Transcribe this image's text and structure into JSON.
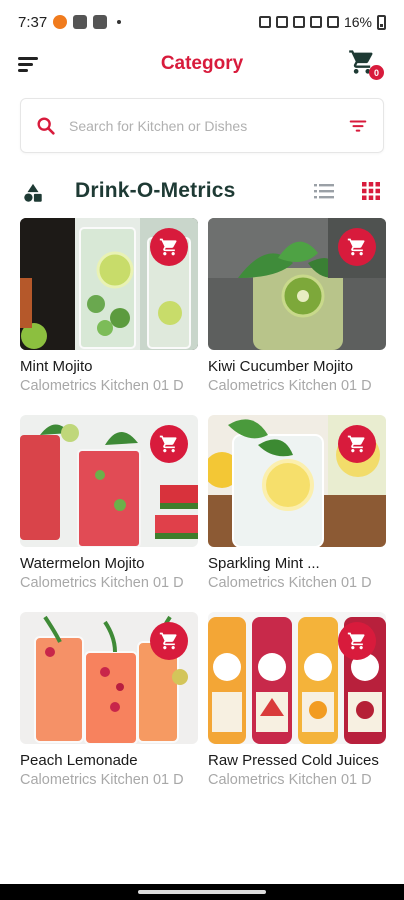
{
  "status_bar": {
    "time": "7:37",
    "battery": "16%"
  },
  "header": {
    "title": "Category",
    "cart_count": "0"
  },
  "search": {
    "placeholder": "Search for Kitchen or Dishes"
  },
  "section": {
    "title": "Drink-O-Metrics"
  },
  "colors": {
    "accent": "#d81b3c",
    "section_title": "#1e3a34",
    "subtext": "#a8a8a8"
  },
  "products": [
    {
      "name": "Mint Mojito",
      "kitchen": "Calometrics Kitchen 01 D",
      "image": "mint-mojito-photo"
    },
    {
      "name": "Kiwi Cucumber Mojito",
      "kitchen": "Calometrics Kitchen 01 D",
      "image": "kiwi-mojito-photo"
    },
    {
      "name": "Watermelon Mojito",
      "kitchen": "Calometrics Kitchen 01 D",
      "image": "watermelon-mojito-photo"
    },
    {
      "name": "Sparkling Mint ...",
      "kitchen": "Calometrics Kitchen 01 D",
      "image": "sparkling-mint-photo"
    },
    {
      "name": "Peach Lemonade",
      "kitchen": "Calometrics Kitchen 01 D",
      "image": "peach-lemonade-photo"
    },
    {
      "name": "Raw Pressed Cold Juices",
      "kitchen": "Calometrics Kitchen 01 D",
      "image": "cold-juices-photo"
    }
  ]
}
